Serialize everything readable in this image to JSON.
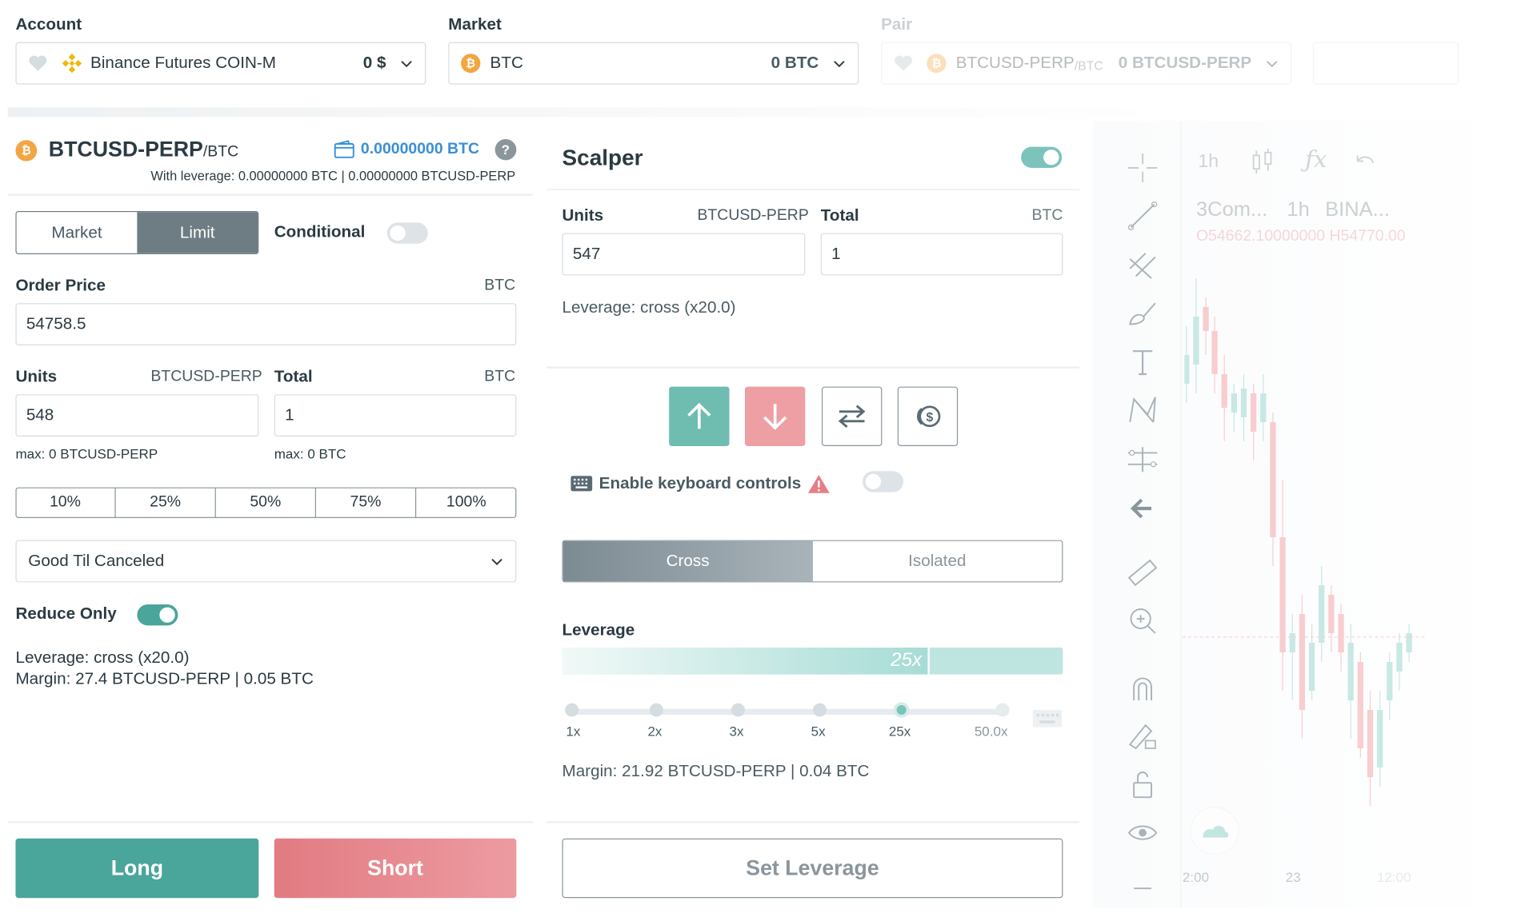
{
  "header": {
    "account_label": "Account",
    "account_name": "Binance Futures COIN-M",
    "account_balance": "0 $",
    "market_label": "Market",
    "market_name": "BTC",
    "market_balance": "0 BTC",
    "pair_label": "Pair",
    "pair_name": "BTCUSD-PERP",
    "pair_quote": "/BTC",
    "pair_balance": "0 BTCUSD-PERP"
  },
  "order": {
    "pair_name": "BTCUSD-PERP",
    "pair_quote": "/BTC",
    "wallet_balance": "0.00000000 BTC",
    "with_leverage": "With leverage: 0.00000000 BTC | 0.00000000 BTCUSD-PERP",
    "tab_market": "Market",
    "tab_limit": "Limit",
    "conditional_label": "Conditional",
    "order_price_label": "Order Price",
    "order_price_unit": "BTC",
    "order_price_value": "54758.5",
    "units_label": "Units",
    "units_unit": "BTCUSD-PERP",
    "units_value": "548",
    "total_label": "Total",
    "total_unit": "BTC",
    "total_value": "1",
    "units_max": "max: 0 BTCUSD-PERP",
    "total_max": "max: 0 BTC",
    "percents": [
      "10%",
      "25%",
      "50%",
      "75%",
      "100%"
    ],
    "time_in_force": "Good Til Canceled",
    "reduce_only_label": "Reduce Only",
    "leverage_text": "Leverage: cross (x20.0)",
    "margin_text": "Margin: 27.4 BTCUSD-PERP | 0.05 BTC",
    "long_label": "Long",
    "short_label": "Short"
  },
  "scalper": {
    "title": "Scalper",
    "units_label": "Units",
    "units_unit": "BTCUSD-PERP",
    "units_value": "547",
    "total_label": "Total",
    "total_unit": "BTC",
    "total_value": "1",
    "leverage_text": "Leverage: cross (x20.0)",
    "keyboard_label": "Enable keyboard controls"
  },
  "leverage": {
    "tab_cross": "Cross",
    "tab_isolated": "Isolated",
    "label": "Leverage",
    "current": "25x",
    "current_fraction": 0.73,
    "ticks": [
      "1x",
      "2x",
      "3x",
      "5x",
      "25x",
      "50.0x"
    ],
    "margin_text": "Margin: 21.92 BTCUSD-PERP | 0.04 BTC",
    "set_button": "Set Leverage"
  },
  "chart": {
    "interval": "1h",
    "legend_name": "3Com...",
    "legend_interval": "1h",
    "legend_exchange": "BINA...",
    "ohlc_text": "O54662.10000000  H54770.00",
    "time_labels": [
      "2:00",
      "23",
      "12:00"
    ]
  },
  "colors": {
    "accent": "#4aa59b",
    "long": "#4aa59b",
    "short": "#e57f86",
    "link": "#3a8fd6",
    "bitcoin": "#f2a541",
    "binance": "#f0b90b"
  }
}
